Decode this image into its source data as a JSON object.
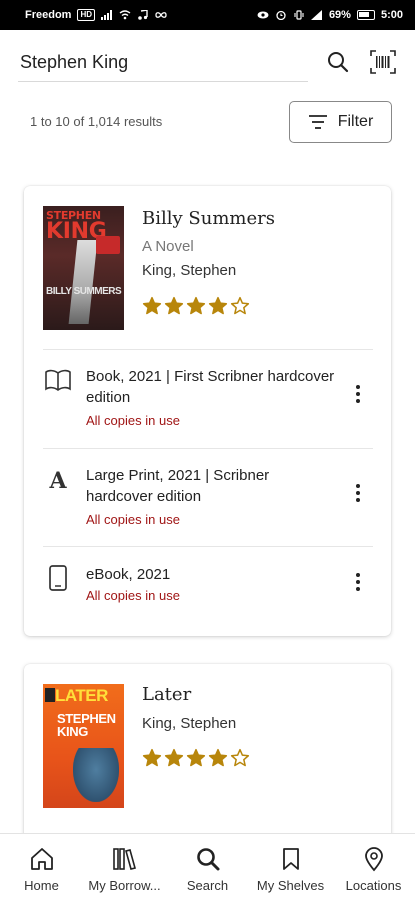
{
  "status_bar": {
    "carrier": "Freedom",
    "carrier_badge": "HD",
    "battery": "69%",
    "time": "5:00"
  },
  "search": {
    "value": "Stephen King",
    "placeholder": "Search"
  },
  "results": {
    "count_text": "1 to 10 of 1,014 results",
    "filter_label": "Filter"
  },
  "books": [
    {
      "title": "Billy Summers",
      "subtitle": "A Novel",
      "author": "King, Stephen",
      "rating": 4,
      "rating_max": 5,
      "cover": {
        "author_small": "STEPHEN",
        "author_big": "KING",
        "title": "BILLY SUMMERS"
      },
      "formats": [
        {
          "icon": "book-icon",
          "label": "Book, 2021 | First Scribner hardcover edition",
          "availability": "All copies in use"
        },
        {
          "icon": "large-print-icon",
          "label": "Large Print, 2021 | Scribner hardcover edition",
          "availability": "All copies in use"
        },
        {
          "icon": "ebook-icon",
          "label": "eBook, 2021",
          "availability": "All copies in use"
        }
      ]
    },
    {
      "title": "Later",
      "subtitle": "",
      "author": "King, Stephen",
      "rating": 4,
      "rating_max": 5,
      "cover": {
        "title": "LATER",
        "author": "STEPHEN KING"
      }
    }
  ],
  "nav": [
    {
      "label": "Home",
      "icon": "home-icon"
    },
    {
      "label": "My Borrow...",
      "icon": "library-icon"
    },
    {
      "label": "Search",
      "icon": "search-icon"
    },
    {
      "label": "My Shelves",
      "icon": "bookmark-icon"
    },
    {
      "label": "Locations",
      "icon": "location-pin-icon"
    }
  ],
  "colors": {
    "star": "#B8860B",
    "availability": "#A01616",
    "status_bar": "#000000"
  }
}
